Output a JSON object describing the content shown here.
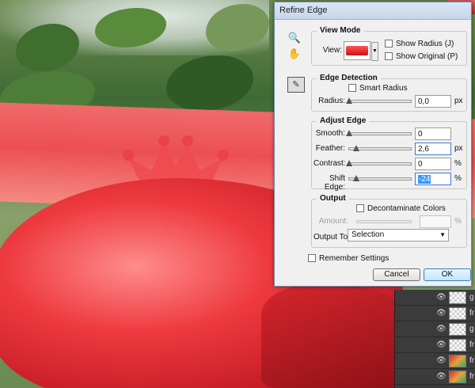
{
  "dialog": {
    "title": "Refine Edge",
    "view_mode": {
      "heading": "View Mode",
      "view_label": "View:",
      "show_radius": "Show Radius (J)",
      "show_original": "Show Original (P)"
    },
    "edge_detection": {
      "heading": "Edge Detection",
      "smart_radius": "Smart Radius",
      "radius_label": "Radius:",
      "radius_value": "0,0",
      "radius_unit": "px",
      "radius_level": 0
    },
    "adjust_edge": {
      "heading": "Adjust Edge",
      "smooth_label": "Smooth:",
      "smooth_value": "0",
      "smooth_level": 0,
      "feather_label": "Feather:",
      "feather_value": "2,6",
      "feather_unit": "px",
      "feather_level": 0.12,
      "contrast_label": "Contrast:",
      "contrast_value": "0",
      "contrast_unit": "%",
      "contrast_level": 0,
      "shift_label": "Shift Edge:",
      "shift_value": "-24",
      "shift_unit": "%",
      "shift_level": 0.12
    },
    "output": {
      "heading": "Output",
      "decontaminate": "Decontaminate Colors",
      "amount_label": "Amount:",
      "amount_unit": "%",
      "output_to_label": "Output To:",
      "output_to_value": "Selection"
    },
    "remember": "Remember Settings",
    "cancel": "Cancel",
    "ok": "OK"
  },
  "window": {
    "close": "✕"
  },
  "layers": {
    "names": [
      "g",
      "fr",
      "g",
      "fr",
      "fr",
      "fr",
      "fr"
    ]
  },
  "icons": {
    "zoom": "zoom-icon",
    "hand": "hand-icon",
    "brush": "refine-radius-brush-icon"
  }
}
